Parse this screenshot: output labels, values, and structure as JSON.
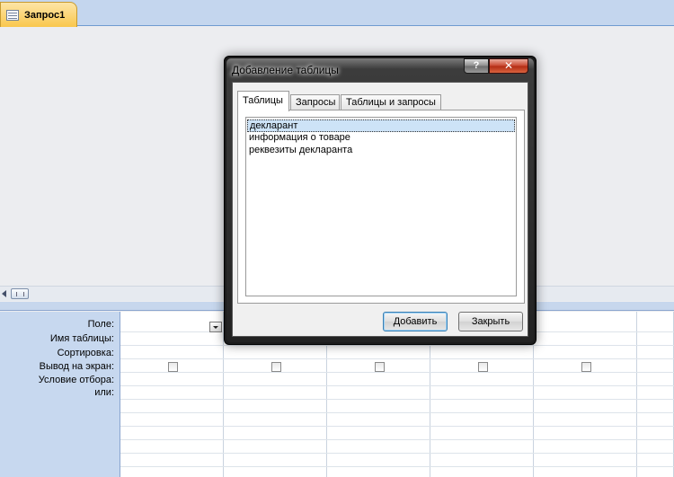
{
  "document_tab": {
    "title": "Запрос1",
    "icon": "query-icon"
  },
  "qbe_grid": {
    "row_labels": [
      "Поле:",
      "Имя таблицы:",
      "Сортировка:",
      "Вывод на экран:",
      "Условие отбора:",
      "или:"
    ],
    "field_dropdown_icon": "chevron-down-icon",
    "show_checkboxes": 5
  },
  "dialog": {
    "title": "Добавление таблицы",
    "help_label": "?",
    "close_label": "✕",
    "tabs": [
      {
        "label": "Таблицы",
        "active": true
      },
      {
        "label": "Запросы",
        "active": false
      },
      {
        "label": "Таблицы и запросы",
        "active": false
      }
    ],
    "list_items": [
      {
        "label": "декларант",
        "selected": true
      },
      {
        "label": "информация о товаре",
        "selected": false
      },
      {
        "label": "реквезиты декларанта",
        "selected": false
      }
    ],
    "add_button": "Добавить",
    "close_button": "Закрыть"
  }
}
